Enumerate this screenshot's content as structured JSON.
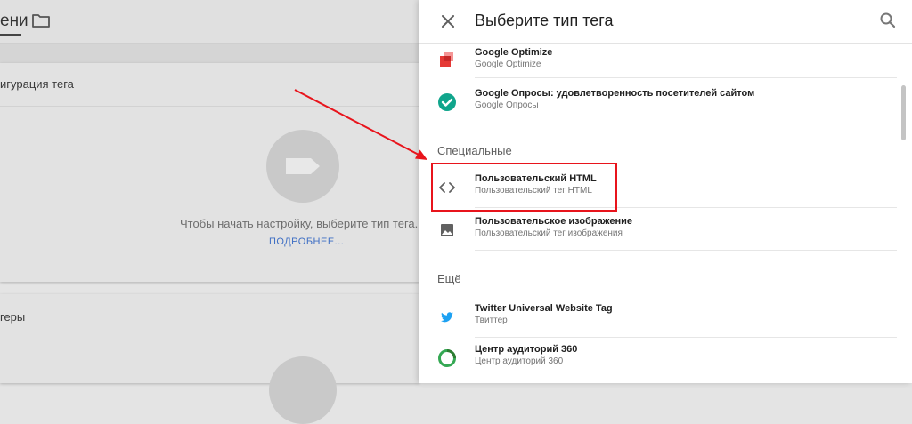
{
  "background": {
    "title_fragment": "ени",
    "card1_label": "игурация тега",
    "hint": "Чтобы начать настройку, выберите тип тега.",
    "more_link": "ПОДРОБНЕЕ...",
    "card2_label": "геры"
  },
  "panel": {
    "title": "Выберите тип тега",
    "items_top": [
      {
        "name": "Google Optimize",
        "sub": "Google Optimize",
        "icon": "google-optimize-icon"
      },
      {
        "name": "Google Опросы: удовлетворенность посетителей сайтом",
        "sub": "Google Опросы",
        "icon": "google-surveys-icon"
      }
    ],
    "section_special": "Специальные",
    "items_special": [
      {
        "name": "Пользовательский HTML",
        "sub": "Пользовательский тег HTML",
        "icon": "code-icon"
      },
      {
        "name": "Пользовательское изображение",
        "sub": "Пользовательский тег изображения",
        "icon": "image-icon"
      }
    ],
    "section_more": "Ещё",
    "items_more": [
      {
        "name": "Twitter Universal Website Tag",
        "sub": "Твиттер",
        "icon": "twitter-icon"
      },
      {
        "name": "Центр аудиторий 360",
        "sub": "Центр аудиторий 360",
        "icon": "audience-center-icon"
      }
    ]
  },
  "colors": {
    "highlight": "#e8141c",
    "link": "#3f6fc4",
    "surveys": "#10a58c",
    "optimize": "#e53935",
    "twitter": "#1da1f2"
  }
}
